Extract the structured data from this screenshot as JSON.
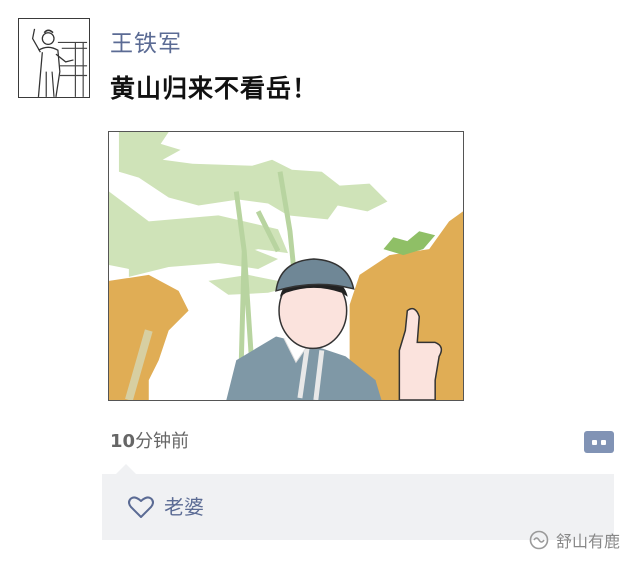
{
  "post": {
    "username": "王铁军",
    "text": "黄山归来不看岳！",
    "time_number": "10",
    "time_suffix": "分钟前"
  },
  "likes": {
    "names": "老婆"
  },
  "watermark": {
    "label": "舒山有鹿"
  },
  "icons": {
    "heart": "heart-outline-icon",
    "comment": "comment-dots-icon",
    "watermark": "wechat-channel-icon"
  },
  "colors": {
    "name_blue": "#5b6b94",
    "comment_button": "#8193b5",
    "panel_bg": "#f0f1f3",
    "pine_green": "#cfe3b8",
    "rock_orange": "#e0ad55",
    "jacket_blue": "#7f98a6",
    "cap_blue": "#6f8796"
  }
}
